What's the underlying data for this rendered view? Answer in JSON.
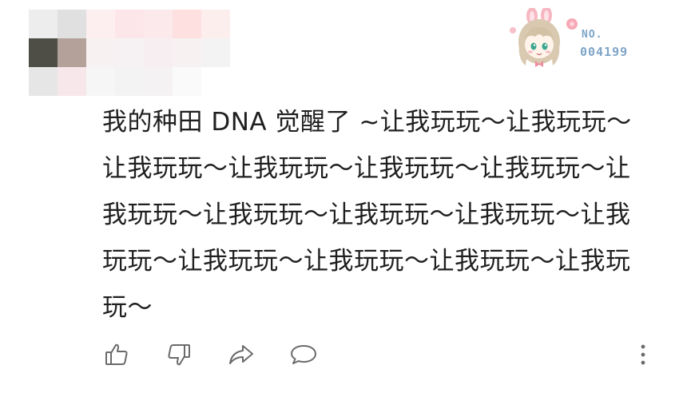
{
  "comment": {
    "text": "我的种田 DNA 觉醒了 ~让我玩玩～让我玩玩～让我玩玩～让我玩玩～让我玩玩～让我玩玩～让我玩玩～让我玩玩～让我玩玩～让我玩玩～让我玩玩～让我玩玩～让我玩玩～让我玩玩～让我玩玩～"
  },
  "badge": {
    "label": "NO.",
    "number": "004199"
  },
  "actions": {
    "like_icon": "thumbs-up-icon",
    "dislike_icon": "thumbs-down-icon",
    "share_icon": "share-icon",
    "reply_icon": "comment-icon",
    "more_icon": "more-vertical-icon"
  },
  "colors": {
    "text": "#1f1f1f",
    "badge_number": "#7ea4c8",
    "icon": "#6a6a6a"
  }
}
